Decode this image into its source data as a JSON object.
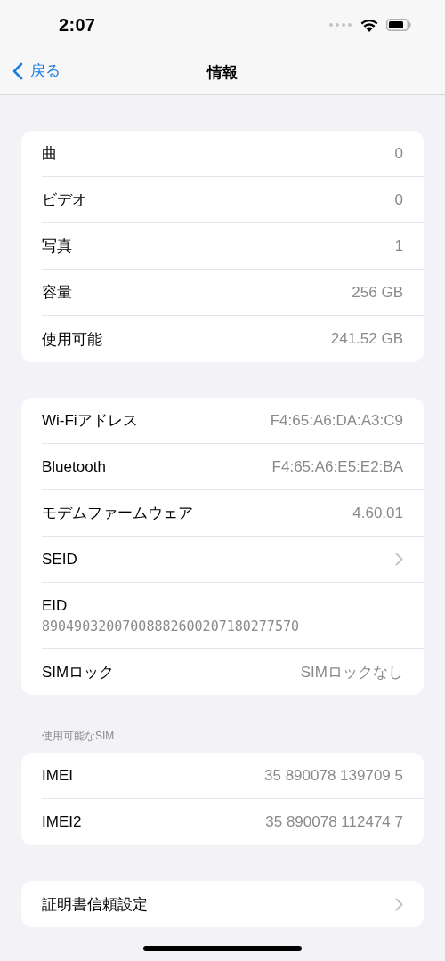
{
  "status_bar": {
    "time": "2:07"
  },
  "nav_bar": {
    "back": "戻る",
    "title": "情報"
  },
  "sections": [
    {
      "rows": [
        {
          "kind": "value",
          "label": "曲",
          "value": "0"
        },
        {
          "kind": "value",
          "label": "ビデオ",
          "value": "0"
        },
        {
          "kind": "value",
          "label": "写真",
          "value": "1"
        },
        {
          "kind": "value",
          "label": "容量",
          "value": "256 GB"
        },
        {
          "kind": "value",
          "label": "使用可能",
          "value": "241.52 GB"
        }
      ]
    },
    {
      "rows": [
        {
          "kind": "value",
          "label": "Wi-Fiアドレス",
          "value": "F4:65:A6:DA:A3:C9"
        },
        {
          "kind": "value",
          "label": "Bluetooth",
          "value": "F4:65:A6:E5:E2:BA"
        },
        {
          "kind": "value",
          "label": "モデムファームウェア",
          "value": "4.60.01"
        },
        {
          "kind": "link",
          "label": "SEID"
        },
        {
          "kind": "stacked",
          "label": "EID",
          "value": "89049032007008882600207180277570"
        },
        {
          "kind": "value",
          "label": "SIMロック",
          "value": "SIMロックなし"
        }
      ]
    },
    {
      "header": "使用可能なSIM",
      "rows": [
        {
          "kind": "value",
          "label": "IMEI",
          "value": "35 890078 139709 5"
        },
        {
          "kind": "value",
          "label": "IMEI2",
          "value": "35 890078 112474 7"
        }
      ]
    },
    {
      "rows": [
        {
          "kind": "link",
          "label": "証明書信頼設定"
        }
      ]
    }
  ]
}
